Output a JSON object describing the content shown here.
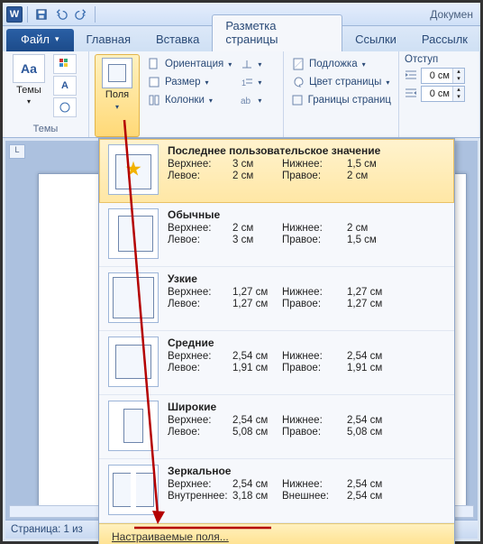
{
  "title": "Докумен",
  "qat": {
    "word": "W"
  },
  "tabs": {
    "file": "Файл",
    "home": "Главная",
    "insert": "Вставка",
    "layout": "Разметка страницы",
    "refs": "Ссылки",
    "mail": "Рассылк"
  },
  "ribbon": {
    "themes_big": "Темы",
    "themes_group": "Темы",
    "margins": "Поля",
    "orientation": "Ориентация",
    "size": "Размер",
    "columns": "Колонки",
    "watermark": "Подложка",
    "pagecolor": "Цвет страницы",
    "borders": "Границы страниц",
    "indent_header": "Отступ",
    "indent_left": "0 см",
    "indent_right": "0 см",
    "aa": "Aa"
  },
  "presets": [
    {
      "key": "last",
      "title": "Последнее пользовательское значение",
      "l1a": "Верхнее:",
      "l1b": "3 см",
      "l1c": "Нижнее:",
      "l1d": "1,5 см",
      "l2a": "Левое:",
      "l2b": "2 см",
      "l2c": "Правое:",
      "l2d": "2 см",
      "t": 10,
      "b": 5,
      "l": 7,
      "r": 7,
      "star": true
    },
    {
      "key": "normal",
      "title": "Обычные",
      "l1a": "Верхнее:",
      "l1b": "2 см",
      "l1c": "Нижнее:",
      "l1d": "2 см",
      "l2a": "Левое:",
      "l2b": "3 см",
      "l2c": "Правое:",
      "l2d": "1,5 см",
      "t": 7,
      "b": 7,
      "l": 10,
      "r": 5
    },
    {
      "key": "narrow",
      "title": "Узкие",
      "l1a": "Верхнее:",
      "l1b": "1,27 см",
      "l1c": "Нижнее:",
      "l1d": "1,27 см",
      "l2a": "Левое:",
      "l2b": "1,27 см",
      "l2c": "Правое:",
      "l2d": "1,27 см",
      "t": 4,
      "b": 4,
      "l": 4,
      "r": 4
    },
    {
      "key": "moderate",
      "title": "Средние",
      "l1a": "Верхнее:",
      "l1b": "2,54 см",
      "l1c": "Нижнее:",
      "l1d": "2,54 см",
      "l2a": "Левое:",
      "l2b": "1,91 см",
      "l2c": "Правое:",
      "l2d": "1,91 см",
      "t": 8,
      "b": 8,
      "l": 7,
      "r": 7
    },
    {
      "key": "wide",
      "title": "Широкие",
      "l1a": "Верхнее:",
      "l1b": "2,54 см",
      "l1c": "Нижнее:",
      "l1d": "2,54 см",
      "l2a": "Левое:",
      "l2b": "5,08 см",
      "l2c": "Правое:",
      "l2d": "5,08 см",
      "t": 8,
      "b": 8,
      "l": 16,
      "r": 16
    },
    {
      "key": "mirror",
      "title": "Зеркальное",
      "l1a": "Верхнее:",
      "l1b": "2,54 см",
      "l1c": "Нижнее:",
      "l1d": "2,54 см",
      "l2a": "Внутреннее:",
      "l2b": "3,18 см",
      "l2c": "Внешнее:",
      "l2d": "2,54 см",
      "t": 8,
      "b": 8,
      "l": 11,
      "r": 8,
      "mirror": true
    }
  ],
  "custom_margins": "Настраиваемые поля...",
  "status": "Страница: 1 из",
  "ruler_corner": "L"
}
